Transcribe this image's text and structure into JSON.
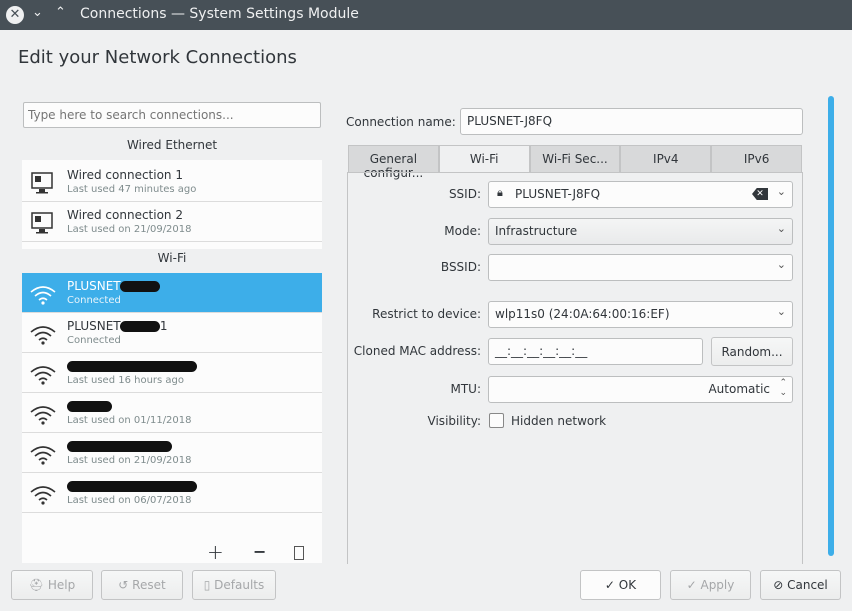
{
  "window": {
    "title": "Connections — System Settings Module"
  },
  "heading": "Edit your Network Connections",
  "search": {
    "placeholder": "Type here to search connections..."
  },
  "sections": {
    "wired": "Wired Ethernet",
    "wifi": "Wi-Fi"
  },
  "wired": [
    {
      "name": "Wired connection 1",
      "sub": "Last used 47 minutes ago"
    },
    {
      "name": "Wired connection 2",
      "sub": "Last used on 21/09/2018"
    }
  ],
  "wifi": [
    {
      "name": "PLUSNET-",
      "suffix": "",
      "sub": "Connected",
      "selected": true
    },
    {
      "name": "PLUSNET-",
      "suffix": "1",
      "sub": "Connected"
    },
    {
      "name": "",
      "suffix": "",
      "sub": "Last used 16 hours ago"
    },
    {
      "name": "",
      "suffix": "",
      "sub": "Last used on 01/11/2018"
    },
    {
      "name": "",
      "suffix": "",
      "sub": "Last used on 21/09/2018"
    },
    {
      "name": "",
      "suffix": "",
      "sub": "Last used on 06/07/2018"
    }
  ],
  "list_toolbar": {
    "add": "+",
    "remove": "−"
  },
  "connection_name": {
    "label": "Connection name:",
    "value": "PLUSNET-J8FQ"
  },
  "tabs": [
    "General configur...",
    "Wi-Fi",
    "Wi-Fi Sec...",
    "IPv4",
    "IPv6"
  ],
  "active_tab": "Wi-Fi",
  "form": {
    "ssid": {
      "label": "SSID:",
      "value": "PLUSNET-J8FQ"
    },
    "mode": {
      "label": "Mode:",
      "value": "Infrastructure"
    },
    "bssid": {
      "label": "BSSID:",
      "value": ""
    },
    "device": {
      "label": "Restrict to device:",
      "value": "wlp11s0 (24:0A:64:00:16:EF)"
    },
    "mac": {
      "label": "Cloned MAC address:",
      "value": "__:__:__:__:__:__",
      "button": "Random..."
    },
    "mtu": {
      "label": "MTU:",
      "value": "Automatic"
    },
    "visibility": {
      "label": "Visibility:",
      "checkbox": "Hidden network",
      "checked": false
    }
  },
  "buttons": {
    "help": "Help",
    "reset": "Reset",
    "defaults": "Defaults",
    "ok": "OK",
    "apply": "Apply",
    "cancel": "Cancel"
  },
  "colors": {
    "accent": "#3daee9",
    "titlebar": "#475057"
  }
}
